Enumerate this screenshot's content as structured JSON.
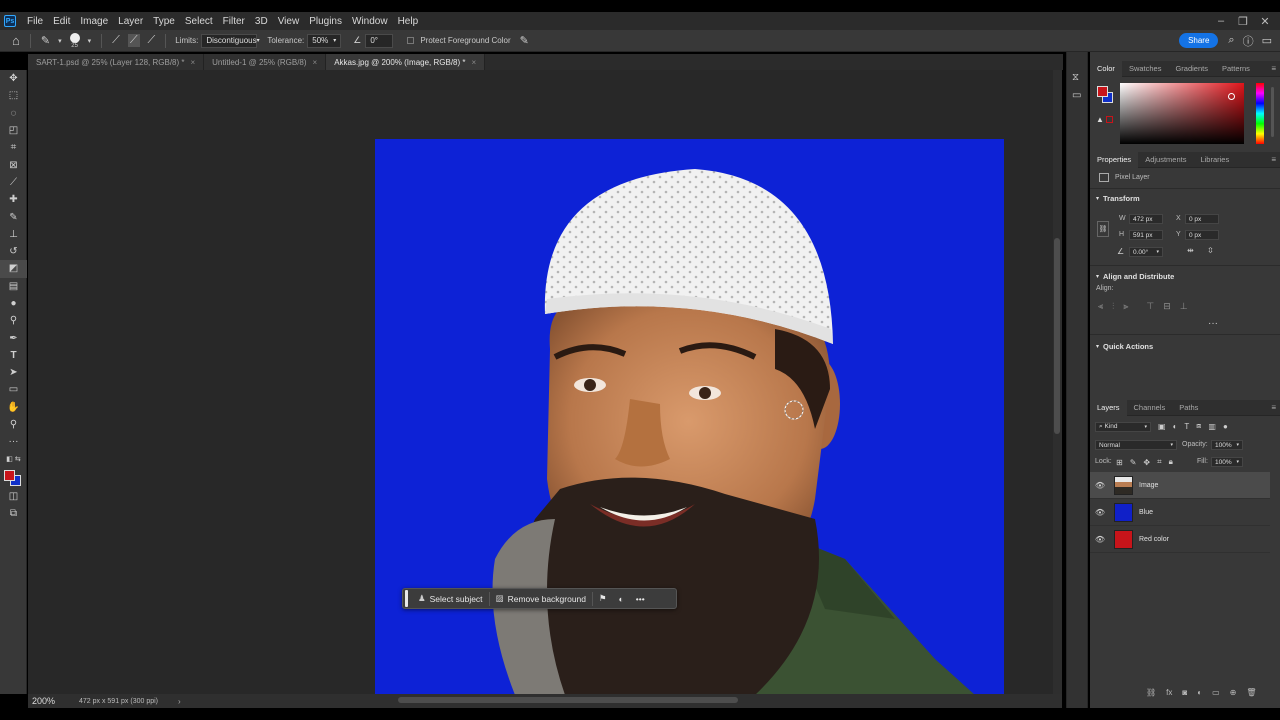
{
  "app": {
    "logo": "Ps",
    "menu": [
      "File",
      "Edit",
      "Image",
      "Layer",
      "Type",
      "Select",
      "Filter",
      "3D",
      "View",
      "Plugins",
      "Window",
      "Help"
    ],
    "window_controls": [
      "–",
      "❐",
      "✕"
    ]
  },
  "options_bar": {
    "brush_size": "25",
    "limits_label": "Limits:",
    "limits_value": "Discontiguous",
    "tolerance_label": "Tolerance:",
    "tolerance_value": "50%",
    "angle_value": "0°",
    "protect_label": "Protect Foreground Color",
    "share_label": "Share"
  },
  "tabs": [
    {
      "label": "SART-1.psd @ 25% (Layer 128, RGB/8) *",
      "active": false
    },
    {
      "label": "Untitled-1 @ 25% (RGB/8)",
      "active": false
    },
    {
      "label": "Akkas.jpg @ 200% (Image, RGB/8) *",
      "active": true
    }
  ],
  "task_bar": {
    "select_subject": "Select subject",
    "remove_background": "Remove background",
    "more": "•••"
  },
  "status": {
    "zoom": "200%",
    "doc_info": "472 px x 591 px (300 ppi)"
  },
  "color_panel": {
    "tabs": [
      "Color",
      "Swatches",
      "Gradients",
      "Patterns"
    ],
    "foreground": "#c8141a",
    "background": "#1030c8"
  },
  "properties_panel": {
    "tabs": [
      "Properties",
      "Adjustments",
      "Libraries"
    ],
    "layer_type": "Pixel Layer",
    "transform_title": "Transform",
    "w_label": "W",
    "w_value": "472 px",
    "h_label": "H",
    "h_value": "591 px",
    "x_label": "X",
    "x_value": "0 px",
    "y_label": "Y",
    "y_value": "0 px",
    "angle_value": "0.00°",
    "align_title": "Align and Distribute",
    "align_label": "Align:",
    "quick_actions_title": "Quick Actions"
  },
  "layers_panel": {
    "tabs": [
      "Layers",
      "Channels",
      "Paths"
    ],
    "filter_label": "Kind",
    "blend_mode": "Normal",
    "opacity_label": "Opacity:",
    "opacity_value": "100%",
    "lock_label": "Lock:",
    "fill_label": "Fill:",
    "fill_value": "100%",
    "layers": [
      {
        "name": "Image",
        "selected": true,
        "color": "#4a6a4a"
      },
      {
        "name": "Blue",
        "selected": false,
        "color": "#1020c8"
      },
      {
        "name": "Red color",
        "selected": false,
        "color": "#c8141a"
      }
    ]
  }
}
